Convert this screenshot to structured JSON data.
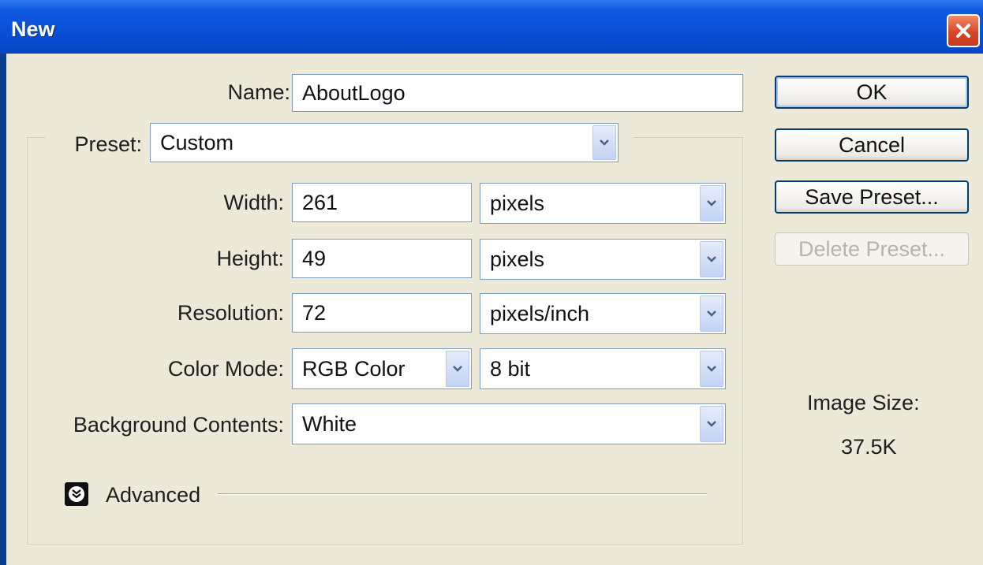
{
  "window": {
    "title": "New"
  },
  "form": {
    "name_label": "Name:",
    "name_value": "AboutLogo",
    "preset_label": "Preset:",
    "preset_value": "Custom",
    "width_label": "Width:",
    "width_value": "261",
    "width_unit": "pixels",
    "height_label": "Height:",
    "height_value": "49",
    "height_unit": "pixels",
    "resolution_label": "Resolution:",
    "resolution_value": "72",
    "resolution_unit": "pixels/inch",
    "colormode_label": "Color Mode:",
    "colormode_value": "RGB Color",
    "bitdepth_value": "8 bit",
    "background_label": "Background Contents:",
    "background_value": "White",
    "advanced_label": "Advanced"
  },
  "buttons": {
    "ok": "OK",
    "cancel": "Cancel",
    "save_preset": "Save Preset...",
    "delete_preset": "Delete Preset..."
  },
  "info": {
    "image_size_label": "Image Size:",
    "image_size_value": "37.5K"
  },
  "icons": {
    "close": "close-icon",
    "dropdown": "chevron-down-icon",
    "advanced": "double-chevron-down-icon"
  },
  "colors": {
    "titlebar": "#0a4fd6",
    "client_bg": "#ece9d8",
    "close_button": "#d8462a"
  }
}
